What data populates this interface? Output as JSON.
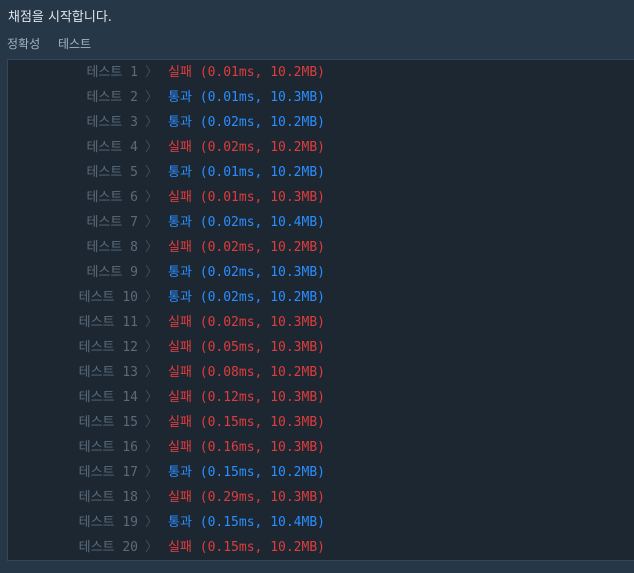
{
  "header": {
    "status_text": "채점을 시작합니다."
  },
  "subtitle": {
    "category": "정확성",
    "section": "테스트"
  },
  "separator_glyph": "〉",
  "tests": [
    {
      "label": "테스트 1",
      "result": "실패",
      "detail": "(0.01ms, 10.2MB)",
      "passed": false
    },
    {
      "label": "테스트 2",
      "result": "통과",
      "detail": "(0.01ms, 10.3MB)",
      "passed": true
    },
    {
      "label": "테스트 3",
      "result": "통과",
      "detail": "(0.02ms, 10.2MB)",
      "passed": true
    },
    {
      "label": "테스트 4",
      "result": "실패",
      "detail": "(0.02ms, 10.2MB)",
      "passed": false
    },
    {
      "label": "테스트 5",
      "result": "통과",
      "detail": "(0.01ms, 10.2MB)",
      "passed": true
    },
    {
      "label": "테스트 6",
      "result": "실패",
      "detail": "(0.01ms, 10.3MB)",
      "passed": false
    },
    {
      "label": "테스트 7",
      "result": "통과",
      "detail": "(0.02ms, 10.4MB)",
      "passed": true
    },
    {
      "label": "테스트 8",
      "result": "실패",
      "detail": "(0.02ms, 10.2MB)",
      "passed": false
    },
    {
      "label": "테스트 9",
      "result": "통과",
      "detail": "(0.02ms, 10.3MB)",
      "passed": true
    },
    {
      "label": "테스트 10",
      "result": "통과",
      "detail": "(0.02ms, 10.2MB)",
      "passed": true
    },
    {
      "label": "테스트 11",
      "result": "실패",
      "detail": "(0.02ms, 10.3MB)",
      "passed": false
    },
    {
      "label": "테스트 12",
      "result": "실패",
      "detail": "(0.05ms, 10.3MB)",
      "passed": false
    },
    {
      "label": "테스트 13",
      "result": "실패",
      "detail": "(0.08ms, 10.2MB)",
      "passed": false
    },
    {
      "label": "테스트 14",
      "result": "실패",
      "detail": "(0.12ms, 10.3MB)",
      "passed": false
    },
    {
      "label": "테스트 15",
      "result": "실패",
      "detail": "(0.15ms, 10.3MB)",
      "passed": false
    },
    {
      "label": "테스트 16",
      "result": "실패",
      "detail": "(0.16ms, 10.3MB)",
      "passed": false
    },
    {
      "label": "테스트 17",
      "result": "통과",
      "detail": "(0.15ms, 10.2MB)",
      "passed": true
    },
    {
      "label": "테스트 18",
      "result": "실패",
      "detail": "(0.29ms, 10.3MB)",
      "passed": false
    },
    {
      "label": "테스트 19",
      "result": "통과",
      "detail": "(0.15ms, 10.4MB)",
      "passed": true
    },
    {
      "label": "테스트 20",
      "result": "실패",
      "detail": "(0.15ms, 10.2MB)",
      "passed": false
    }
  ],
  "colors": {
    "pass": "#2b8eff",
    "fail": "#e03c3c",
    "label": "#5a6b7b",
    "background": "#263747",
    "panel": "#1c2732"
  }
}
